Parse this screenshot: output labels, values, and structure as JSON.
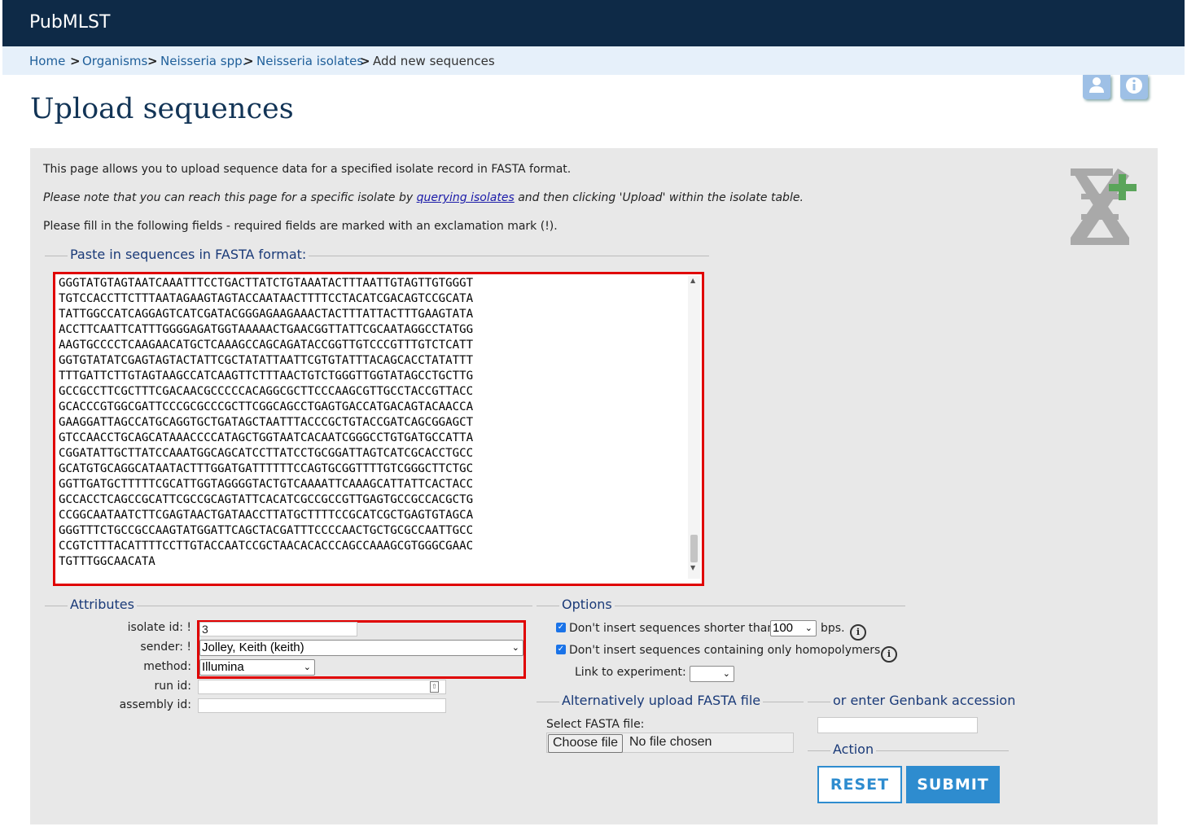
{
  "header": {
    "brand": "PubMLST"
  },
  "breadcrumb": {
    "items": [
      "Home",
      "Organisms",
      "Neisseria spp.",
      "Neisseria isolates"
    ],
    "separator": ">",
    "current": "Add new sequences"
  },
  "page": {
    "title": "Upload sequences"
  },
  "toolbar": {
    "user_icon": "user-icon",
    "info_icon": "info-icon"
  },
  "intro": {
    "line1": "This page allows you to upload sequence data for a specified isolate record in FASTA format.",
    "line2_pre": "Please note that you can reach this page for a specific isolate by ",
    "line2_link": "querying isolates",
    "line2_post": " and then clicking 'Upload' within the isolate table.",
    "line3": "Please fill in the following fields - required fields are marked with an exclamation mark (!)."
  },
  "fasta": {
    "legend": "Paste in sequences in FASTA format:",
    "content": "GGGTATGTAGTAATCAAATTTCCTGACTTATCTGTAAATACTTTAATTGTAGTTGTGGGT\nTGTCCACCTTCTTTAATAGAAGTAGTACCAATAACTTTTCCTACATCGACAGTCCGCATA\nTATTGGCCATCAGGAGTCATCGATACGGGAGAAGAAACTACTTTATTACTTTGAAGTATA\nACCTTCAATTCATTTGGGGAGATGGTAAAAACTGAACGGTTATTCGCAATAGGCCTATGG\nAAGTGCCCCTCAAGAACATGCTCAAAGCCAGCAGATACCGGTTGTCCCGTTTGTCTCATT\nGGTGTATATCGAGTAGTACTATTCGCTATATTAATTCGTGTATTTACAGCACCTATATTT\nTTTGATTCTTGTAGTAAGCCATCAAGTTCTTTAACTGTCTGGGTTGGTATAGCCTGCTTG\nGCCGCCTTCGCTTTCGACAACGCCCCCACAGGCGCTTCCCAAGCGTTGCCTACCGTTACC\nGCACCCGTGGCGATTCCCGCGCCCGCTTCGGCAGCCTGAGTGACCATGACAGTACAACCA\nGAAGGATTAGCCATGCAGGTGCTGATAGCTAATTTACCCGCTGTACCGATCAGCGGAGCT\nGTCCAACCTGCAGCATAAACCCCATAGCTGGTAATCACAATCGGGCCTGTGATGCCATTA\nCGGATATTGCTTATCCAAATGGCAGCATCCTTATCCTGCGGATTAGTCATCGCACCTGCC\nGCATGTGCAGGCATAATACTTTGGATGATTTTTTCCAGTGCGGTTTTGTCGGGCTTCTGC\nGGTTGATGCTTTTTCGCATTGGTAGGGGTACTGTCAAAATTCAAAGCATTATTCACTACC\nGCCACCTCAGCCGCATTCGCCGCAGTATTCACATCGCCGCCGTTGAGTGCCGCCACGCTG\nCCGGCAATAATCTTCGAGTAACTGATAACCTTATGCTTTTCCGCATCGCTGAGTGTAGCA\nGGGTTTCTGCCGCCAAGTATGGATTCAGCTACGATTTCCCCAACTGCTGCGCCAATTGCC\nCCGTCTTTACATTTTCCTTGTACCAATCCGCTAACACACCCAGCCAAAGCGTGGGCGAAC\nTGTTTGGCAACATA"
  },
  "attributes": {
    "legend": "Attributes",
    "isolate_id_label": "isolate id: !",
    "isolate_id_value": "3",
    "sender_label": "sender: !",
    "sender_value": "Jolley, Keith (keith)",
    "method_label": "method:",
    "method_value": "Illumina",
    "run_id_label": "run id:",
    "run_id_value": "",
    "assembly_id_label": "assembly id:",
    "assembly_id_value": ""
  },
  "options": {
    "legend": "Options",
    "min_length_label": "Don't insert sequences shorter than",
    "min_length_value": "100",
    "min_length_unit": "bps.",
    "homopolymer_label": "Don't insert sequences containing only homopolymers.",
    "experiment_label": "Link to experiment:",
    "experiment_value": ""
  },
  "upload_file": {
    "legend": "Alternatively upload FASTA file",
    "select_label": "Select FASTA file:",
    "button_label": "Choose file",
    "status": "No file chosen"
  },
  "genbank": {
    "legend": "or enter Genbank accession",
    "value": ""
  },
  "action": {
    "legend": "Action",
    "reset_label": "RESET",
    "submit_label": "SUBMIT"
  }
}
